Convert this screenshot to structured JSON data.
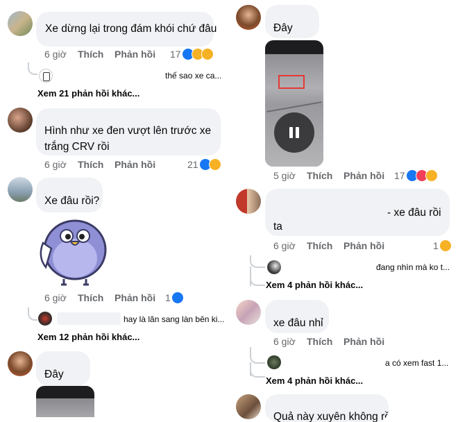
{
  "left": {
    "c1": {
      "text": "Xe dừng lại trong đám khói chứ đâu",
      "time": "6 giờ",
      "like": "Thích",
      "reply": "Phản hồi",
      "count": "17",
      "sub": {
        "text": "thế sao xe ca...",
        "more": "Xem 21 phản hồi khác..."
      }
    },
    "c2": {
      "text_line1": "Hình như xe đen vượt lên trước xe",
      "text_line2": "trắng CRV rồi",
      "time": "6 giờ",
      "like": "Thích",
      "reply": "Phản hồi",
      "count": "21"
    },
    "c3": {
      "text": "Xe đâu rồi?",
      "time": "6 giờ",
      "like": "Thích",
      "reply": "Phản hồi",
      "count": "1",
      "sub": {
        "text": "hay là lăn sang làn bên ki...",
        "more": "Xem 12 phản hồi khác..."
      }
    },
    "c4": {
      "text": "Đây"
    }
  },
  "right": {
    "c1": {
      "text": "Đây",
      "time": "5 giờ",
      "like": "Thích",
      "reply": "Phản hồi",
      "count": "17"
    },
    "c2": {
      "text_line1": "- xe đâu rồi",
      "text_line2": "ta",
      "time": "6 giờ",
      "like": "Thích",
      "reply": "Phản hồi",
      "count": "1",
      "sub": {
        "text": "đang nhìn mà ko t...",
        "more": "Xem 4 phản hồi khác..."
      }
    },
    "c3": {
      "text": "xe đâu nhỉ",
      "time": "6 giờ",
      "like": "Thích",
      "reply": "Phản hồi",
      "sub": {
        "text": "a có xem fast 1...",
        "more": "Xem 4 phản hồi khác..."
      }
    },
    "c4": {
      "text": "Quả này xuyên không rồi"
    }
  },
  "icons": {
    "like": "like-reaction-icon",
    "haha": "haha-reaction-icon",
    "love": "love-reaction-icon",
    "pause": "pause-icon"
  }
}
